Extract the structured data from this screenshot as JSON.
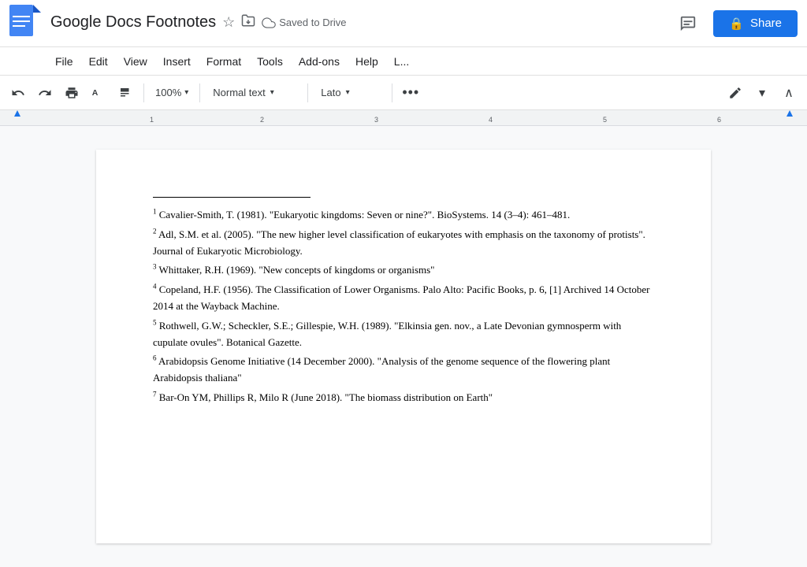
{
  "header": {
    "app_icon_alt": "Google Docs",
    "doc_title": "Google Docs Footnotes",
    "save_status": "Saved to Drive",
    "comment_icon": "💬",
    "share_label": "Share",
    "lock_icon": "🔒"
  },
  "menu": {
    "items": [
      "File",
      "Edit",
      "View",
      "Insert",
      "Format",
      "Tools",
      "Add-ons",
      "Help",
      "L..."
    ]
  },
  "toolbar": {
    "undo_icon": "↩",
    "redo_icon": "↪",
    "print_icon": "🖨",
    "paint_format_icon": "A",
    "paint_roller_icon": "🎨",
    "zoom_value": "100%",
    "style_value": "Normal text",
    "font_value": "Lato",
    "more_icon": "⋯",
    "edit_icon": "✏",
    "expand_icon": "∧"
  },
  "document": {
    "footnotes": [
      {
        "num": "1",
        "text": "Cavalier-Smith, T. (1981). \"Eukaryotic kingdoms: Seven or nine?\". BioSystems. 14 (3–4): 461–481."
      },
      {
        "num": "2",
        "text": "Adl, S.M. et al. (2005). \"The new higher level classification of eukaryotes with emphasis on the taxonomy of protists\". Journal of Eukaryotic Microbiology."
      },
      {
        "num": "3",
        "text": "Whittaker, R.H. (1969). \"New concepts of kingdoms or organisms\""
      },
      {
        "num": "4",
        "text": "Copeland, H.F. (1956). The Classification of Lower Organisms. Palo Alto: Pacific Books, p. 6, [1] Archived 14 October 2014 at the Wayback Machine."
      },
      {
        "num": "5",
        "text": "Rothwell, G.W.; Scheckler, S.E.; Gillespie, W.H. (1989). \"Elkinsia gen. nov., a Late Devonian gymnosperm with cupulate ovules\". Botanical Gazette."
      },
      {
        "num": "6",
        "text": "Arabidopsis Genome Initiative (14 December 2000). \"Analysis of the genome sequence of the flowering plant Arabidopsis thaliana\""
      },
      {
        "num": "7",
        "text": "Bar-On YM, Phillips R, Milo R (June 2018). \"The biomass distribution on Earth\""
      }
    ]
  },
  "icons": {
    "star": "☆",
    "folder_move": "⊡",
    "cloud": "☁",
    "chevron_down": "▾",
    "lock": "🔒"
  }
}
